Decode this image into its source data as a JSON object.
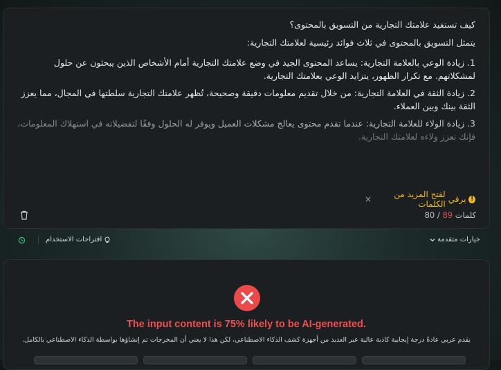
{
  "editor": {
    "question": "كيف تستفيد علامتك التجارية من التسويق بالمحتوى؟",
    "intro": "يتمثل التسويق بالمحتوى في ثلاث فوائد رئيسية لعلامتك التجارية:",
    "points": [
      "1. زيادة الوعي بالعلامة التجارية: يساعد المحتوى الجيد في وضع علامتك التجارية أمام الأشخاص الذين يبحثون عن حلول لمشكلاتهم. مع تكرار الظهور، يتزايد الوعي بعلامتك التجارية.",
      "2. زيادة الثقة في العلامة التجارية: من خلال تقديم معلومات دقيقة وصحيحة، تُظهر علامتك التجارية سلطتها في المجال، مما يعزز الثقة بينك وبين العملاء.",
      "3. زيادة الولاء للعلامة التجارية: عندما تقدم محتوى يعالج مشكلات العميل ويوفر له الحلول وفقًا لتفضيلاته في استهلاك المعلومات، فإنك تعزز ولاءه لعلامتك التجارية."
    ],
    "upgrade_prefix": "يرقي",
    "upgrade_link": "لفتح المزيد من الكلمات",
    "close_symbol": "×",
    "word_count": "80",
    "word_separator": "/",
    "word_limit": "89",
    "words_label": "كلمات"
  },
  "toolbar": {
    "suggestions_label": "اقتراحات الاستخدام",
    "advanced_label": "خيارات متقدمة"
  },
  "result": {
    "title": "The input content is 75% likely to be AI-generated.",
    "description": "يقدم عربي عادةً درجة إيجابية كاذبة عالية عبر العديد من أجهزة كشف الذكاء الاصطناعي، لكن هذا لا يعني أن المخرجات تم إنشاؤها بواسطة الذكاء الاصطناعي بالكامل."
  },
  "colors": {
    "accent_warning": "#f2b824",
    "danger": "#ea4a4a",
    "success": "#3fbf7f"
  },
  "icons": [
    "warning-icon",
    "trash-icon",
    "history-icon",
    "lightbulb-icon",
    "chevron-down-icon",
    "error-x-icon"
  ]
}
